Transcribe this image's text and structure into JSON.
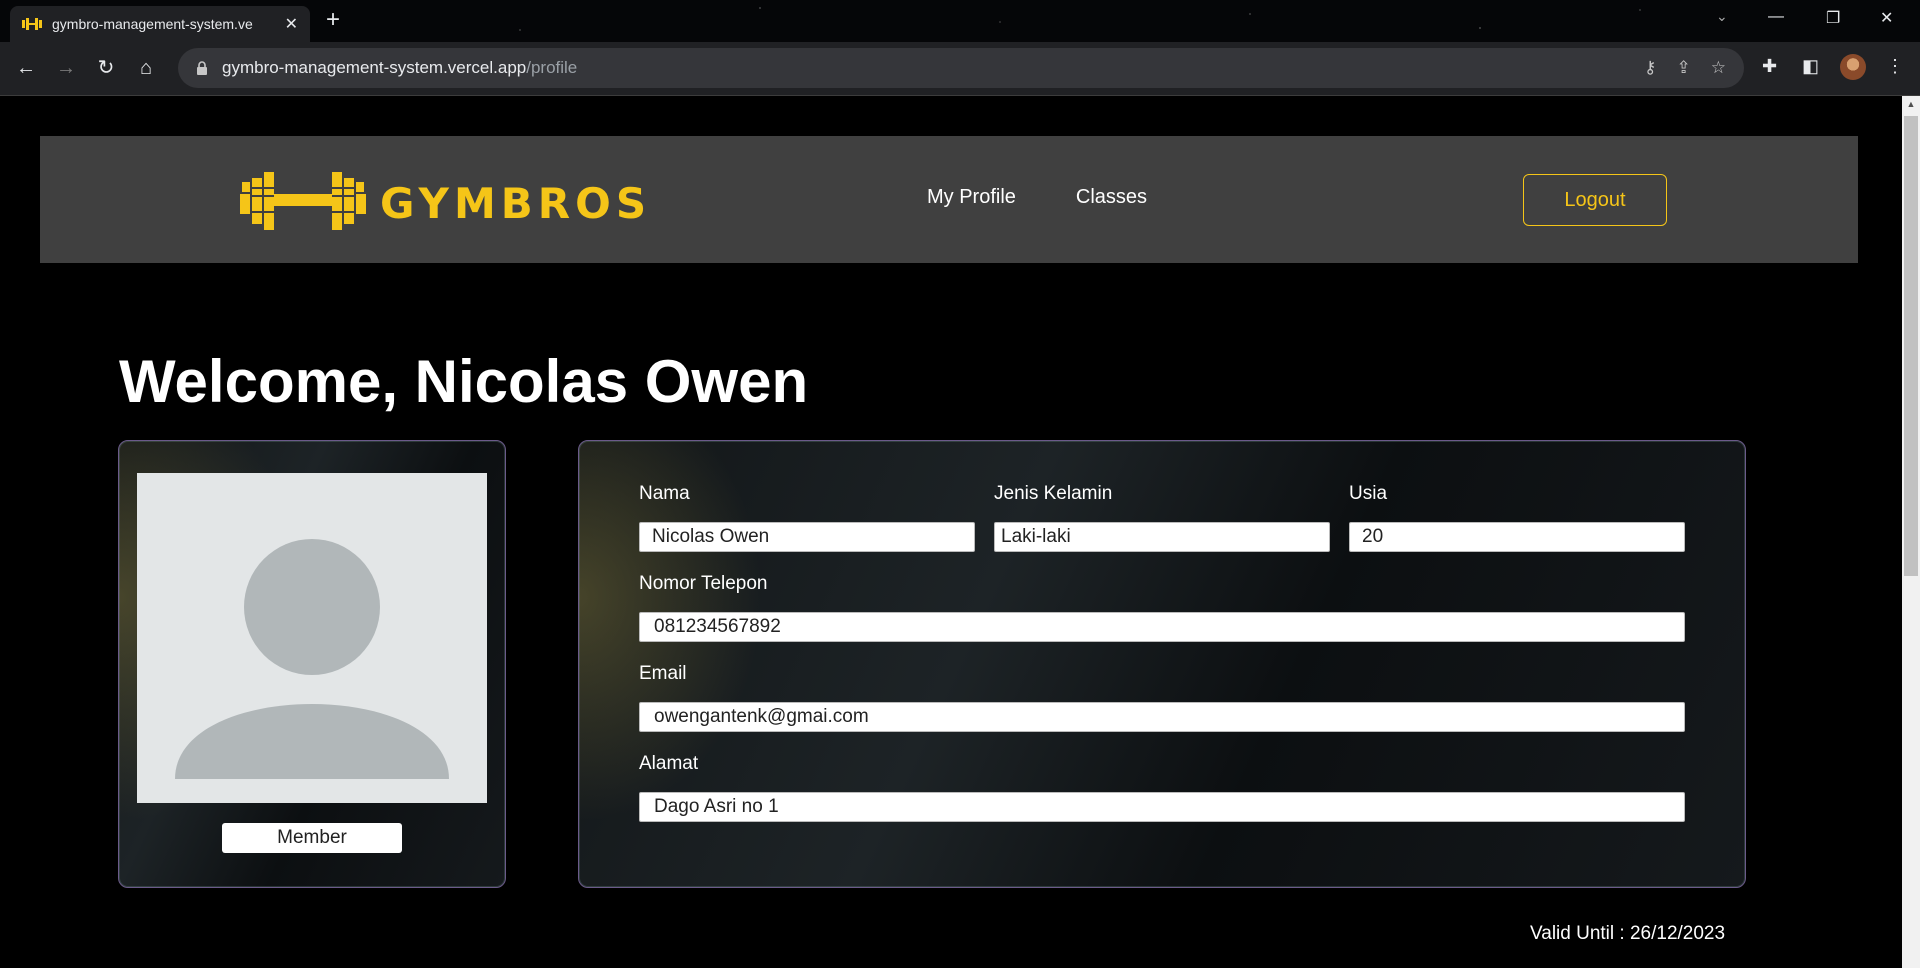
{
  "browser": {
    "tab_title": "gymbro-management-system.ve",
    "url_host": "gymbro-management-system.vercel.app",
    "url_path": "/profile"
  },
  "site": {
    "brand": "GYMBROS",
    "nav": [
      "My Profile",
      "Classes"
    ],
    "logout_label": "Logout",
    "accent_color": "#f5c518"
  },
  "profile": {
    "welcome": "Welcome, Nicolas Owen",
    "role_badge": "Member",
    "fields": {
      "nama": {
        "label": "Nama",
        "value": "Nicolas Owen"
      },
      "jenis_kelamin": {
        "label": "Jenis Kelamin",
        "value": "Laki-laki"
      },
      "usia": {
        "label": "Usia",
        "value": "20"
      },
      "telepon": {
        "label": "Nomor Telepon",
        "value": "081234567892"
      },
      "email": {
        "label": "Email",
        "value": "owengantenk@gmai.com"
      },
      "alamat": {
        "label": "Alamat",
        "value": "Dago Asri no 1"
      }
    },
    "valid_until": "Valid Until : 26/12/2023"
  }
}
